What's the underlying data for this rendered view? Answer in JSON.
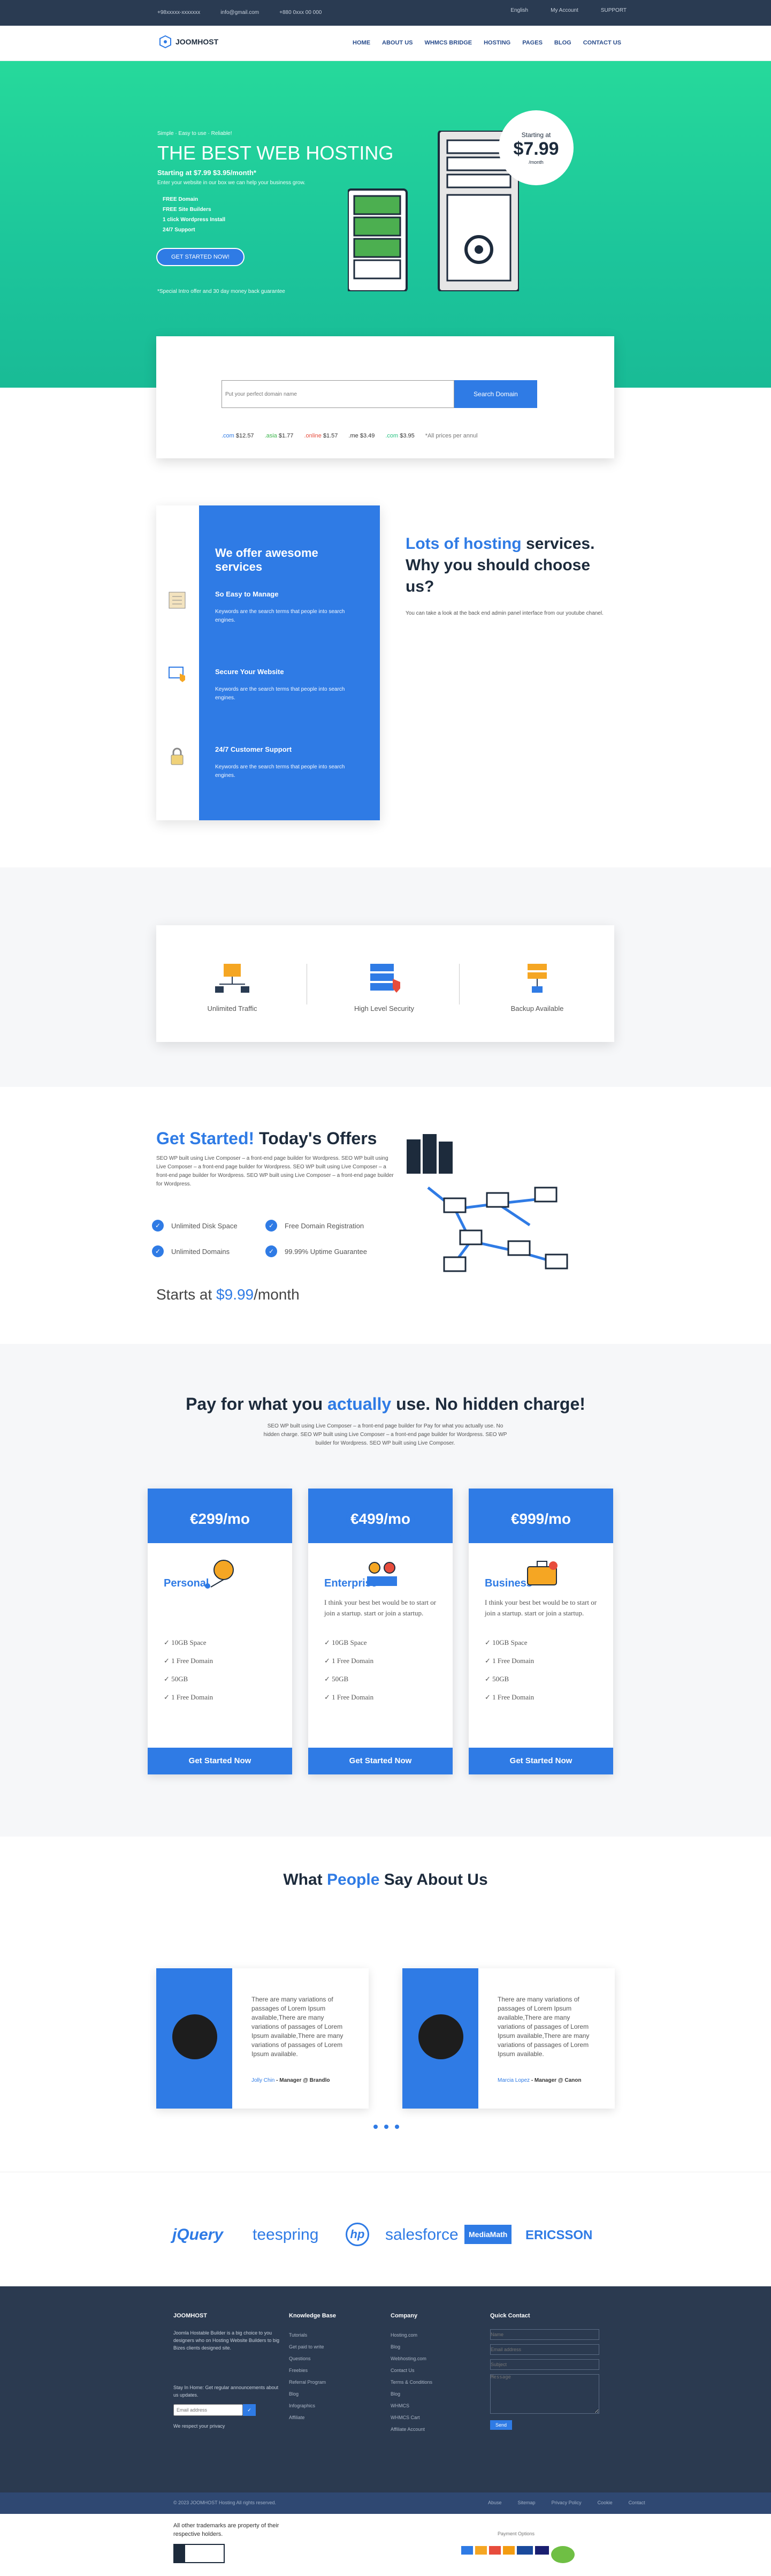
{
  "topbar": {
    "phone": "+98xxxxx-xxxxxxx",
    "email": "info@gmail.com",
    "hours": "+880 0xxx 00 000",
    "lang": "English",
    "account": "My Account",
    "support": "SUPPORT"
  },
  "header": {
    "logo": "JOOMHOST",
    "nav": [
      "HOME",
      "ABOUT US",
      "WHMCS BRIDGE",
      "HOSTING",
      "PAGES",
      "BLOG",
      "CONTACT US"
    ]
  },
  "hero": {
    "kicker": "Simple · Easy to use · Reliable!",
    "title": "THE BEST WEB HOSTING",
    "subtitle": "Starting at $7.99 $3.95/month*",
    "blurb": "Enter your website in our box we can help your business grow.",
    "features": [
      "FREE Domain",
      "FREE Site Builders",
      "1 click Wordpress Install",
      "24/7 Support"
    ],
    "cta": "GET STARTED NOW!",
    "footnote": "*Special Intro offer and 30 day money back guarantee",
    "badge_top": "Starting at",
    "badge_price": "$7.99",
    "badge_sub": "/month"
  },
  "search": {
    "placeholder": "Put your perfect domain name",
    "button": "Search Domain",
    "tlds": [
      {
        "name": ".com",
        "price": "$12.57",
        "color": "#2f7be5"
      },
      {
        "name": ".asia",
        "price": "$1.77",
        "color": "#3ab54a"
      },
      {
        "name": ".online",
        "price": "$1.57",
        "color": "#e74c3c"
      },
      {
        "name": ".me",
        "price": "$3.49",
        "color": "#333333"
      },
      {
        "name": ".com",
        "price": "$3.95",
        "color": "#26c281"
      }
    ],
    "note": "*All prices per annul"
  },
  "services": {
    "title": "We offer awesome services",
    "items": [
      {
        "title": "So Easy to Manage",
        "desc": "Keywords are the search terms that people into search engines."
      },
      {
        "title": "Secure Your Website",
        "desc": "Keywords are the search terms that people into search engines."
      },
      {
        "title": "24/7 Customer Support",
        "desc": "Keywords are the search terms that people into search engines."
      }
    ],
    "why_title_a": "Lots of hosting",
    "why_title_b": "services. Why you should choose us?",
    "why_desc": "You can take a look at the back end admin panel interface from our youtube chanel."
  },
  "features": [
    "Unlimited Traffic",
    "High Level Security",
    "Backup Available"
  ],
  "offers": {
    "title_a": "Get Started!",
    "title_b": "Today's Offers",
    "desc": "SEO WP built using Live Composer – a front-end page builder for Wordpress. SEO WP built using Live Composer – a front-end page builder for Wordpress. SEO WP built using Live Composer – a front-end page builder for Wordpress. SEO WP built using Live Composer – a front-end page builder for Wordpress.",
    "checks": [
      "Unlimited Disk Space",
      "Free Domain Registration",
      "Unlimited Domains",
      "99.99% Uptime Guarantee"
    ],
    "price_label": "Starts at",
    "price": "$9.99",
    "price_unit": "/month"
  },
  "pricing": {
    "title_a": "Pay for what you",
    "title_b": "actually",
    "title_c": "use. No hidden charge!",
    "desc": "SEO WP built using Live Composer – a front-end page builder for Pay for what you actually use. No hidden charge. SEO WP built using Live Composer – a front-end page builder for Wordpress. SEO WP builder for Wordpress. SEO WP built using Live Composer.",
    "plans": [
      {
        "price": "€299/mo",
        "name": "Personal",
        "desc": "",
        "features": [
          "10GB Space",
          "1 Free Domain",
          "50GB",
          "1 Free Domain"
        ],
        "cta": "Get Started Now"
      },
      {
        "price": "€499/mo",
        "name": "Enterprise",
        "desc": "I think your best bet would be to start or join a startup. start or join a startup.",
        "features": [
          "10GB Space",
          "1 Free Domain",
          "50GB",
          "1 Free Domain"
        ],
        "cta": "Get Started Now"
      },
      {
        "price": "€999/mo",
        "name": "Business",
        "desc": "I think your best bet would be to start or join a startup. start or join a startup.",
        "features": [
          "10GB Space",
          "1 Free Domain",
          "50GB",
          "1 Free Domain"
        ],
        "cta": "Get Started Now"
      }
    ]
  },
  "testimonials": {
    "title_a": "What",
    "title_b": "People",
    "title_c": "Say About Us",
    "items": [
      {
        "text": "There are many variations of passages of Lorem Ipsum available,There are many variations of passages of Lorem Ipsum available,There are many variations of passages of Lorem Ipsum available.",
        "name": "Jolly Chin",
        "role": "- Manager @ Brandlo"
      },
      {
        "text": "There are many variations of passages of Lorem Ipsum available,There are many variations of passages of Lorem Ipsum available,There are many variations of passages of Lorem Ipsum available.",
        "name": "Marcia Lopez",
        "role": "- Manager @ Canon"
      }
    ]
  },
  "brands": [
    "jQuery",
    "teespring",
    "hp",
    "salesforce",
    "MediaMath",
    "ERICSSON"
  ],
  "footer": {
    "logo": "JOOMHOST",
    "about": "Joomla Hostable Builder is a big choice to you designers who on Hosting Website Builders to big Bizes clients designed site.",
    "newsletter": "Stay In Home: Get regular announcements about us updates.",
    "email_ph": "Email address",
    "nl_note": "We respect your privacy",
    "kb_title": "Knowledge Base",
    "kb": [
      "Tutorials",
      "Get paid to write",
      "Questions",
      "Freebies",
      "Referral Program",
      "Blog",
      "Infographics",
      "Affiliate"
    ],
    "co_title": "Company",
    "co": [
      "Hosting.com",
      "Blog",
      "Webhosting.com",
      "Contact Us",
      "Terms & Conditions",
      "Blog",
      "WHMCS",
      "WHMCS Cart",
      "Affiliate Account"
    ],
    "qc_title": "Quick Contact",
    "qc_fields": [
      "Name",
      "Email address",
      "Subject",
      "Message"
    ],
    "qc_btn": "Send"
  },
  "subbar": {
    "copy": "© 2023 JOOMHOST Hosting All rights reserved.",
    "links": [
      "Abuse",
      "Sitemap",
      "Privacy Policy",
      "Cookie",
      "Contact"
    ]
  },
  "bottom": {
    "text": "All other trademarks are property of their respective holders.",
    "payment": "Payment Options"
  }
}
